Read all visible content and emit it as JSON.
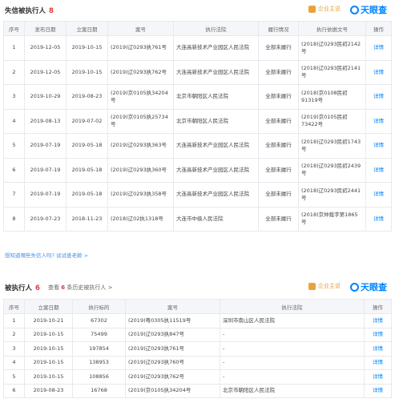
{
  "section1": {
    "title": "失信被执行人",
    "count": "8",
    "brand_qy": "企业主说",
    "brand_tyc": "天眼查",
    "headers": [
      "序号",
      "发布日期",
      "立案日期",
      "案号",
      "执行法院",
      "履行情况",
      "执行依据文号",
      "操作"
    ],
    "rows": [
      {
        "no": "1",
        "pub": "2019-12-05",
        "filed": "2019-10-15",
        "case": "(2019)辽0293执761号",
        "court": "大连高新技术产业园区人民法院",
        "status": "全部未履行",
        "doc": "(2018)辽0293民初2142号",
        "op": "详情"
      },
      {
        "no": "2",
        "pub": "2019-12-05",
        "filed": "2019-10-15",
        "case": "(2019)辽0293执762号",
        "court": "大连高新技术产业园区人民法院",
        "status": "全部未履行",
        "doc": "(2018)辽0293民初2141号",
        "op": "详情"
      },
      {
        "no": "3",
        "pub": "2019-10-29",
        "filed": "2019-08-23",
        "case": "(2019)京0105执34204号",
        "court": "北京市朝阳区人民法院",
        "status": "全部未履行",
        "doc": "(2018)京0108民初91319号",
        "op": "详情"
      },
      {
        "no": "4",
        "pub": "2019-08-13",
        "filed": "2019-07-02",
        "case": "(2019)京0105执25734号",
        "court": "北京市朝阳区人民法院",
        "status": "全部未履行",
        "doc": "(2019)京0105民初73422号",
        "op": "详情"
      },
      {
        "no": "5",
        "pub": "2019-07-19",
        "filed": "2019-05-18",
        "case": "(2019)辽0293执363号",
        "court": "大连高新技术产业园区人民法院",
        "status": "全部未履行",
        "doc": "(2018)辽0293民初1743号",
        "op": "详情"
      },
      {
        "no": "6",
        "pub": "2019-07-19",
        "filed": "2019-05-18",
        "case": "(2019)辽0293执360号",
        "court": "大连高新技术产业园区人民法院",
        "status": "全部未履行",
        "doc": "(2018)辽0293民初2439号",
        "op": "详情"
      },
      {
        "no": "7",
        "pub": "2019-07-19",
        "filed": "2019-05-18",
        "case": "(2019)辽0293执358号",
        "court": "大连高新技术产业园区人民法院",
        "status": "全部未履行",
        "doc": "(2018)辽0293民初2441号",
        "op": "详情"
      },
      {
        "no": "8",
        "pub": "2019-07-23",
        "filed": "2018-11-23",
        "case": "(2018)辽02执1318号",
        "court": "大连市中级人民法院",
        "status": "全部未履行",
        "doc": "(2018)京仲裁字第1865号",
        "op": "详情"
      }
    ],
    "hint": "想知道哪些失信人吗? 试试查老赖 >"
  },
  "section2": {
    "title": "被执行人",
    "count": "6",
    "sub_prefix": "查看",
    "sub_count": "6",
    "sub_suffix": "条历史被执行人 >",
    "brand_qy": "企业主说",
    "brand_tyc": "天眼查",
    "headers": [
      "序号",
      "立案日期",
      "执行标的",
      "案号",
      "执行法院",
      "操作"
    ],
    "rows": [
      {
        "no": "1",
        "filed": "2019-10-21",
        "amount": "67302",
        "case": "(2019)粤0305执11519号",
        "court": "深圳市南山区人民法院",
        "op": "详情"
      },
      {
        "no": "2",
        "filed": "2019-10-15",
        "amount": "75499",
        "case": "(2019)辽0293执847号",
        "court": "-",
        "op": "详情"
      },
      {
        "no": "3",
        "filed": "2019-10-15",
        "amount": "197854",
        "case": "(2019)辽0293执761号",
        "court": "-",
        "op": "详情"
      },
      {
        "no": "4",
        "filed": "2019-10-15",
        "amount": "138953",
        "case": "(2019)辽0293执760号",
        "court": "-",
        "op": "详情"
      },
      {
        "no": "5",
        "filed": "2019-10-15",
        "amount": "108856",
        "case": "(2019)辽0293执762号",
        "court": "-",
        "op": "详情"
      },
      {
        "no": "6",
        "filed": "2019-08-23",
        "amount": "16768",
        "case": "(2019)京0105执34204号",
        "court": "北京市朝阳区人民法院",
        "op": "详情"
      }
    ]
  }
}
